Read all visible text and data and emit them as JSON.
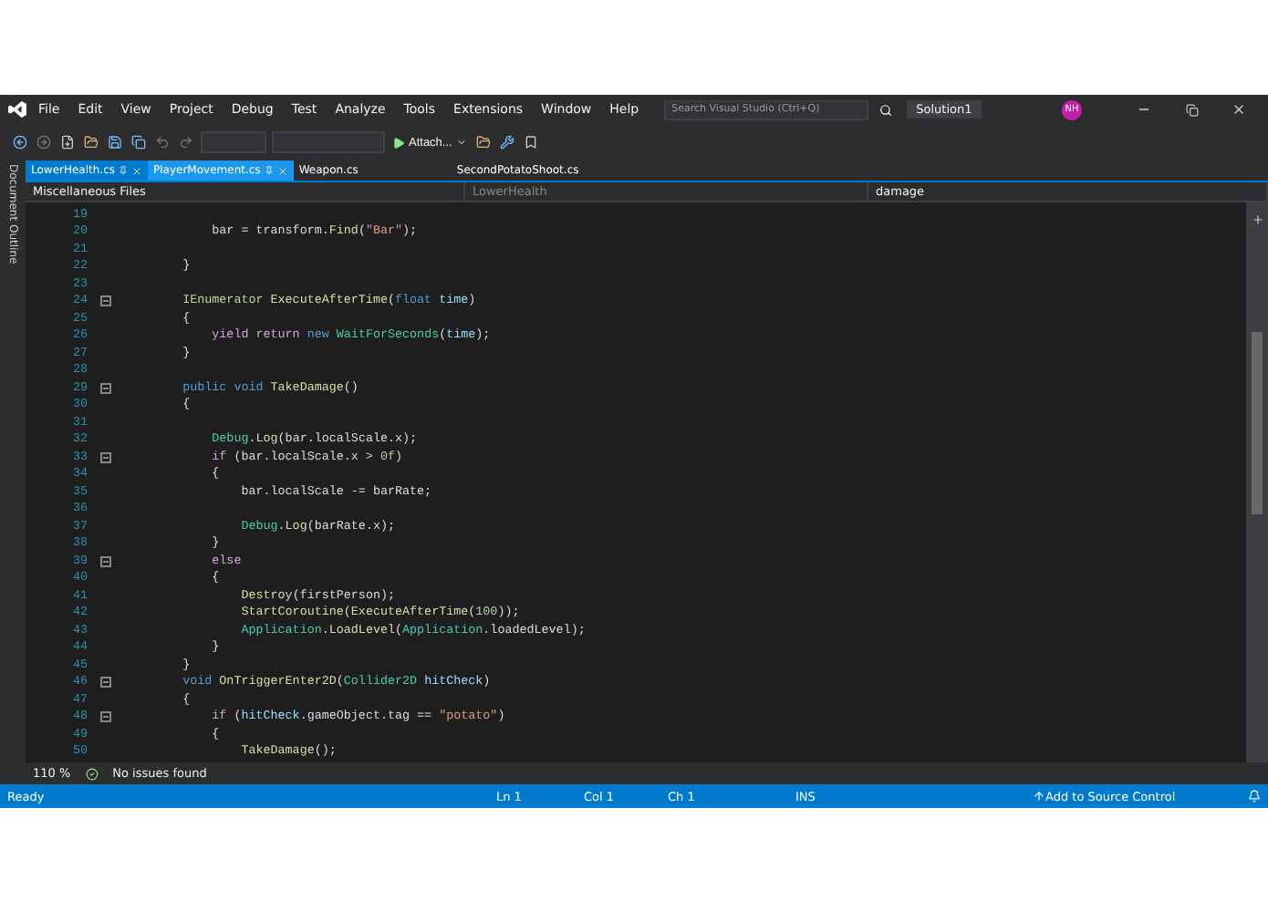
{
  "window": {
    "title": "Solution1",
    "avatar": "NH"
  },
  "menu": [
    "File",
    "Edit",
    "View",
    "Project",
    "Debug",
    "Test",
    "Analyze",
    "Tools",
    "Extensions",
    "Window",
    "Help"
  ],
  "search": {
    "placeholder": "Search Visual Studio (Ctrl+Q)"
  },
  "toolbar": {
    "attach": "Attach..."
  },
  "side_panel": {
    "label": "Document Outline"
  },
  "tabs": [
    {
      "label": "LowerHealth.cs",
      "selected": true,
      "hover": false,
      "closable": true
    },
    {
      "label": "PlayerMovement.cs",
      "selected": false,
      "hover": true,
      "closable": true
    },
    {
      "label": "Weapon.cs",
      "selected": false,
      "hover": false,
      "closable": false
    },
    {
      "label": "SecondPotatoShoot.cs",
      "selected": false,
      "hover": false,
      "closable": false
    }
  ],
  "navigation": {
    "project": "Miscellaneous Files",
    "class": "LowerHealth",
    "member": "damage"
  },
  "code": [
    {
      "n": "19",
      "fold": false
    },
    {
      "n": "20",
      "fold": false,
      "tokens": [
        {
          "text": "            bar = transform.",
          "kind": "p"
        },
        {
          "text": "Find",
          "kind": "m"
        },
        {
          "text": "(",
          "kind": "p"
        },
        {
          "text": "\"Bar\"",
          "kind": "s"
        },
        {
          "text": ");",
          "kind": "p"
        }
      ]
    },
    {
      "n": "21",
      "fold": false
    },
    {
      "n": "22",
      "fold": false,
      "tokens": [
        {
          "text": "        }",
          "kind": "p"
        }
      ]
    },
    {
      "n": "23",
      "fold": false
    },
    {
      "n": "24",
      "fold": true,
      "tokens": [
        {
          "text": "        IEnumerator ",
          "kind": "i"
        },
        {
          "text": "ExecuteAfterTime",
          "kind": "m"
        },
        {
          "text": "(",
          "kind": "p"
        },
        {
          "text": "float ",
          "kind": "k"
        },
        {
          "text": "time",
          "kind": "a"
        },
        {
          "text": ")",
          "kind": "p"
        }
      ]
    },
    {
      "n": "25",
      "fold": false,
      "tokens": [
        {
          "text": "        {",
          "kind": "p"
        }
      ]
    },
    {
      "n": "26",
      "fold": false,
      "tokens": [
        {
          "text": "            yield return ",
          "kind": "c"
        },
        {
          "text": "new ",
          "kind": "k"
        },
        {
          "text": "WaitForSeconds",
          "kind": "t"
        },
        {
          "text": "(",
          "kind": "p"
        },
        {
          "text": "time",
          "kind": "a"
        },
        {
          "text": ");",
          "kind": "p"
        }
      ]
    },
    {
      "n": "27",
      "fold": false,
      "tokens": [
        {
          "text": "        }",
          "kind": "p"
        }
      ]
    },
    {
      "n": "28",
      "fold": false
    },
    {
      "n": "29",
      "fold": true,
      "tokens": [
        {
          "text": "        public void ",
          "kind": "k"
        },
        {
          "text": "TakeDamage",
          "kind": "m"
        },
        {
          "text": "()",
          "kind": "p"
        }
      ]
    },
    {
      "n": "30",
      "fold": false,
      "tokens": [
        {
          "text": "        {",
          "kind": "p"
        }
      ]
    },
    {
      "n": "31",
      "fold": false
    },
    {
      "n": "32",
      "fold": false,
      "tokens": [
        {
          "text": "            Debug",
          "kind": "t"
        },
        {
          "text": ".",
          "kind": "p"
        },
        {
          "text": "Log",
          "kind": "m"
        },
        {
          "text": "(bar.localScale.x);",
          "kind": "p"
        }
      ]
    },
    {
      "n": "33",
      "fold": true,
      "tokens": [
        {
          "text": "            if",
          "kind": "c"
        },
        {
          "text": " (bar.localScale.x > ",
          "kind": "p"
        },
        {
          "text": "0f",
          "kind": "n"
        },
        {
          "text": ")",
          "kind": "p"
        }
      ]
    },
    {
      "n": "34",
      "fold": false,
      "tokens": [
        {
          "text": "            {",
          "kind": "p"
        }
      ]
    },
    {
      "n": "35",
      "fold": false,
      "tokens": [
        {
          "text": "                bar.localScale -= barRate;",
          "kind": "p"
        }
      ]
    },
    {
      "n": "36",
      "fold": false
    },
    {
      "n": "37",
      "fold": false,
      "tokens": [
        {
          "text": "                Debug",
          "kind": "t"
        },
        {
          "text": ".",
          "kind": "p"
        },
        {
          "text": "Log",
          "kind": "m"
        },
        {
          "text": "(barRate.x);",
          "kind": "p"
        }
      ]
    },
    {
      "n": "38",
      "fold": false,
      "tokens": [
        {
          "text": "            }",
          "kind": "p"
        }
      ]
    },
    {
      "n": "39",
      "fold": true,
      "tokens": [
        {
          "text": "            else",
          "kind": "c"
        }
      ]
    },
    {
      "n": "40",
      "fold": false,
      "tokens": [
        {
          "text": "            {",
          "kind": "p"
        }
      ]
    },
    {
      "n": "41",
      "fold": false,
      "tokens": [
        {
          "text": "                Destroy",
          "kind": "m"
        },
        {
          "text": "(firstPerson);",
          "kind": "p"
        }
      ]
    },
    {
      "n": "42",
      "fold": false,
      "tokens": [
        {
          "text": "                StartCoroutine",
          "kind": "m"
        },
        {
          "text": "(",
          "kind": "p"
        },
        {
          "text": "ExecuteAfterTime",
          "kind": "m"
        },
        {
          "text": "(",
          "kind": "p"
        },
        {
          "text": "100",
          "kind": "n"
        },
        {
          "text": "));",
          "kind": "p"
        }
      ]
    },
    {
      "n": "43",
      "fold": false,
      "tokens": [
        {
          "text": "                Application",
          "kind": "t"
        },
        {
          "text": ".",
          "kind": "p"
        },
        {
          "text": "LoadLevel",
          "kind": "m"
        },
        {
          "text": "(",
          "kind": "p"
        },
        {
          "text": "Application",
          "kind": "t"
        },
        {
          "text": ".loadedLevel);",
          "kind": "p"
        }
      ]
    },
    {
      "n": "44",
      "fold": false,
      "tokens": [
        {
          "text": "            }",
          "kind": "p"
        }
      ]
    },
    {
      "n": "45",
      "fold": false,
      "tokens": [
        {
          "text": "        }",
          "kind": "p"
        }
      ]
    },
    {
      "n": "46",
      "fold": true,
      "tokens": [
        {
          "text": "        void ",
          "kind": "k"
        },
        {
          "text": "OnTriggerEnter2D",
          "kind": "m"
        },
        {
          "text": "(",
          "kind": "p"
        },
        {
          "text": "Collider2D ",
          "kind": "t"
        },
        {
          "text": "hitCheck",
          "kind": "a"
        },
        {
          "text": ")",
          "kind": "p"
        }
      ]
    },
    {
      "n": "47",
      "fold": false,
      "tokens": [
        {
          "text": "        {",
          "kind": "p"
        }
      ]
    },
    {
      "n": "48",
      "fold": true,
      "tokens": [
        {
          "text": "            if",
          "kind": "c"
        },
        {
          "text": " (",
          "kind": "p"
        },
        {
          "text": "hitCheck",
          "kind": "a"
        },
        {
          "text": ".gameObject.tag == ",
          "kind": "p"
        },
        {
          "text": "\"potato\"",
          "kind": "s"
        },
        {
          "text": ")",
          "kind": "p"
        }
      ]
    },
    {
      "n": "49",
      "fold": false,
      "tokens": [
        {
          "text": "            {",
          "kind": "p"
        }
      ]
    },
    {
      "n": "50",
      "fold": false,
      "tokens": [
        {
          "text": "                TakeDamage",
          "kind": "m"
        },
        {
          "text": "();",
          "kind": "p"
        }
      ]
    }
  ],
  "editor_footer": {
    "zoom": "110 %",
    "issues": "No issues found"
  },
  "status_bar": {
    "state": "Ready",
    "line": "Ln 1",
    "column": "Col 1",
    "char": "Ch 1",
    "mode": "INS",
    "source_control": "Add to Source Control"
  }
}
